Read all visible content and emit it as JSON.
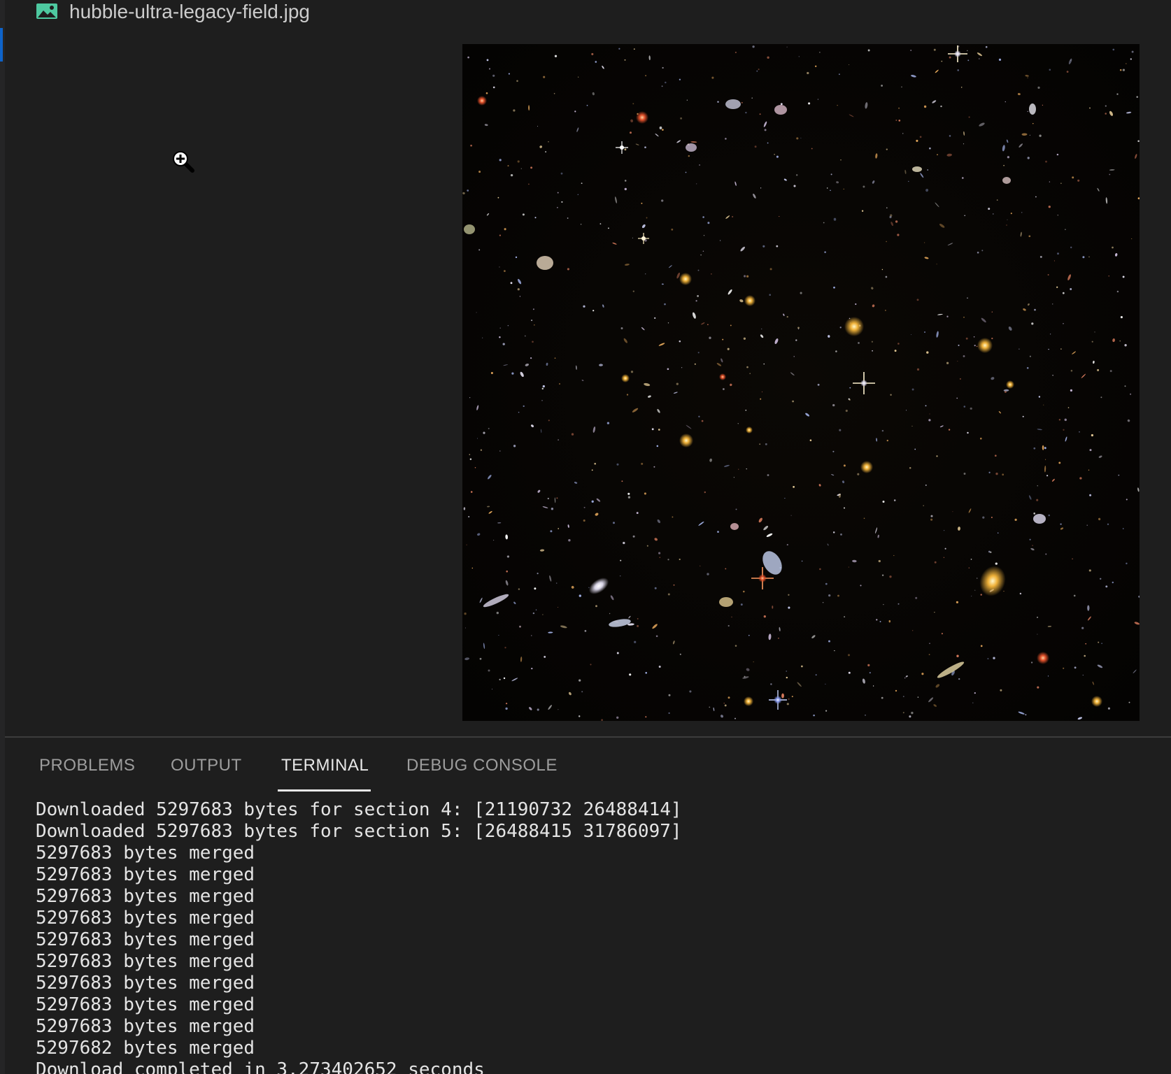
{
  "editor": {
    "tab": {
      "icon": "image-file-icon",
      "file_name": "hubble-ultra-legacy-field.jpg"
    },
    "preview": {
      "cursor_icon": "zoom-in-cursor-icon",
      "image_subject": "Hubble Ultra Deep Field galaxy image"
    }
  },
  "panel": {
    "tabs": [
      {
        "label": "PROBLEMS",
        "active": false
      },
      {
        "label": "OUTPUT",
        "active": false
      },
      {
        "label": "TERMINAL",
        "active": true
      },
      {
        "label": "DEBUG CONSOLE",
        "active": false
      }
    ],
    "terminal": {
      "lines": [
        "Downloaded 5297683 bytes for section 4: [21190732 26488414]",
        "Downloaded 5297683 bytes for section 5: [26488415 31786097]",
        "5297683 bytes merged",
        "5297683 bytes merged",
        "5297683 bytes merged",
        "5297683 bytes merged",
        "5297683 bytes merged",
        "5297683 bytes merged",
        "5297683 bytes merged",
        "5297683 bytes merged",
        "5297683 bytes merged",
        "5297682 bytes merged",
        "Download completed in 3.273402652 seconds"
      ]
    }
  },
  "colors": {
    "background": "#1e1e1e",
    "text": "#cccccc",
    "inactive_tab": "#9d9d9d",
    "active_tab": "#e7e7e7",
    "icon_green": "#4ec9a0",
    "focus_blue": "#0e63c9"
  }
}
